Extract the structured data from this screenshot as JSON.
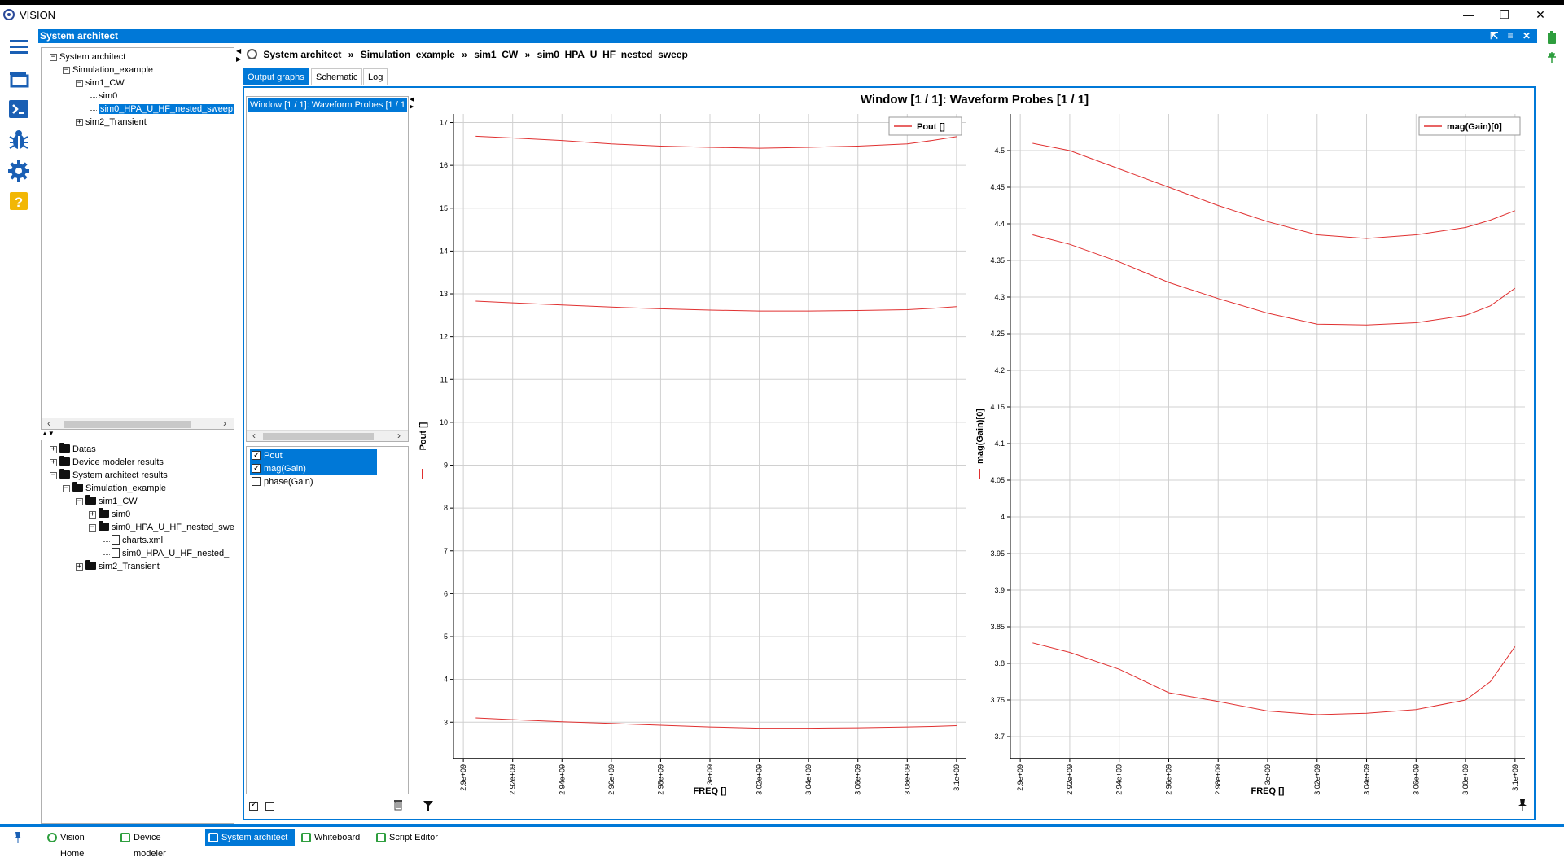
{
  "app": {
    "title": "VISION",
    "window_controls": {
      "minimize": "—",
      "maximize": "❐",
      "close": "✕"
    }
  },
  "pane": {
    "title": "System architect",
    "header_buttons": "⇱ ≡ ✕"
  },
  "left_icons": [
    "menu-icon",
    "folder-stack-icon",
    "terminal-icon",
    "bug-icon",
    "gear-icon",
    "help-icon"
  ],
  "project_tree": {
    "nodes": [
      {
        "label": "System architect",
        "level": 0,
        "toggle": "−"
      },
      {
        "label": "Simulation_example",
        "level": 1,
        "toggle": "−"
      },
      {
        "label": "sim1_CW",
        "level": 2,
        "toggle": "−"
      },
      {
        "label": "sim0",
        "level": 3,
        "toggle": ""
      },
      {
        "label": "sim0_HPA_U_HF_nested_sweep",
        "level": 3,
        "toggle": "",
        "selected": true
      },
      {
        "label": "sim2_Transient",
        "level": 2,
        "toggle": "+"
      }
    ]
  },
  "results_tree": {
    "nodes": [
      {
        "label": "Datas",
        "level": 0,
        "toggle": "+",
        "icon": "folder"
      },
      {
        "label": "Device modeler results",
        "level": 0,
        "toggle": "+",
        "icon": "folder"
      },
      {
        "label": "System architect results",
        "level": 0,
        "toggle": "−",
        "icon": "folder"
      },
      {
        "label": "Simulation_example",
        "level": 1,
        "toggle": "−",
        "icon": "folder"
      },
      {
        "label": "sim1_CW",
        "level": 2,
        "toggle": "−",
        "icon": "folder"
      },
      {
        "label": "sim0",
        "level": 3,
        "toggle": "+",
        "icon": "folder"
      },
      {
        "label": "sim0_HPA_U_HF_nested_swe",
        "level": 3,
        "toggle": "−",
        "icon": "folder"
      },
      {
        "label": "charts.xml",
        "level": 4,
        "toggle": "",
        "icon": "file"
      },
      {
        "label": "sim0_HPA_U_HF_nested_",
        "level": 4,
        "toggle": "",
        "icon": "file"
      },
      {
        "label": "sim2_Transient",
        "level": 2,
        "toggle": "+",
        "icon": "folder"
      }
    ]
  },
  "breadcrumb": [
    "System architect",
    "Simulation_example",
    "sim1_CW",
    "sim0_HPA_U_HF_nested_sweep"
  ],
  "breadcrumb_sep": "»",
  "tabs": [
    {
      "label": "Output graphs",
      "active": true
    },
    {
      "label": "Schematic",
      "active": false
    },
    {
      "label": "Log",
      "active": false
    }
  ],
  "window_list": {
    "selected": "Window [1 / 1]: Waveform Probes [1 / 1"
  },
  "probes": [
    {
      "label": "Pout",
      "checked": true,
      "highlighted": true
    },
    {
      "label": "mag(Gain)",
      "checked": true,
      "highlighted": true
    },
    {
      "label": "phase(Gain)",
      "checked": false,
      "highlighted": false
    }
  ],
  "graph_window_title": "Window [1 / 1]: Waveform Probes [1 / 1]",
  "chart_data": [
    {
      "type": "line",
      "xlabel": "FREQ []",
      "ylabel": "Pout []",
      "xlim": [
        2896000000.0,
        3104000000.0
      ],
      "ylim": [
        2.15,
        17.2
      ],
      "x_ticks": [
        2900000000.0,
        2920000000.0,
        2940000000.0,
        2960000000.0,
        2980000000.0,
        3000000000.0,
        3020000000.0,
        3040000000.0,
        3060000000.0,
        3080000000.0,
        3100000000.0
      ],
      "x_tick_labels": [
        "2.9e+09",
        "2.92e+09",
        "2.94e+09",
        "2.96e+09",
        "2.98e+09",
        "3e+09",
        "3.02e+09",
        "3.04e+09",
        "3.06e+09",
        "3.08e+09",
        "3.1e+09"
      ],
      "y_ticks": [
        3,
        4,
        5,
        6,
        7,
        8,
        9,
        10,
        11,
        12,
        13,
        14,
        15,
        16,
        17
      ],
      "grid": true,
      "legend": "top-right",
      "color": "#e03030",
      "x": [
        2905000000.0,
        2920000000.0,
        2940000000.0,
        2960000000.0,
        2980000000.0,
        3000000000.0,
        3020000000.0,
        3040000000.0,
        3060000000.0,
        3080000000.0,
        3090000000.0,
        3100000000.0
      ],
      "series": [
        {
          "name": "Pout []",
          "values": [
            16.68,
            16.64,
            16.58,
            16.5,
            16.45,
            16.42,
            16.4,
            16.42,
            16.45,
            16.5,
            16.58,
            16.67
          ]
        },
        {
          "name": "Pout []",
          "values": [
            12.83,
            12.79,
            12.74,
            12.69,
            12.65,
            12.62,
            12.6,
            12.6,
            12.61,
            12.63,
            12.66,
            12.7
          ]
        },
        {
          "name": "Pout []",
          "values": [
            3.1,
            3.06,
            3.01,
            2.97,
            2.93,
            2.89,
            2.86,
            2.86,
            2.87,
            2.89,
            2.9,
            2.92
          ]
        }
      ]
    },
    {
      "type": "line",
      "xlabel": "FREQ []",
      "ylabel": "mag(Gain)[0]",
      "xlim": [
        2896000000.0,
        3104000000.0
      ],
      "ylim": [
        3.67,
        4.55
      ],
      "x_ticks": [
        2900000000.0,
        2920000000.0,
        2940000000.0,
        2960000000.0,
        2980000000.0,
        3000000000.0,
        3020000000.0,
        3040000000.0,
        3060000000.0,
        3080000000.0,
        3100000000.0
      ],
      "x_tick_labels": [
        "2.9e+09",
        "2.92e+09",
        "2.94e+09",
        "2.96e+09",
        "2.98e+09",
        "3e+09",
        "3.02e+09",
        "3.04e+09",
        "3.06e+09",
        "3.08e+09",
        "3.1e+09"
      ],
      "y_ticks": [
        3.7,
        3.75,
        3.8,
        3.85,
        3.9,
        3.95,
        4.0,
        4.05,
        4.1,
        4.15,
        4.2,
        4.25,
        4.3,
        4.35,
        4.4,
        4.45,
        4.5
      ],
      "y_tick_labels": [
        "3.7",
        "3.75",
        "3.8",
        "3.85",
        "3.9",
        "3.95",
        "4",
        "4.05",
        "4.1",
        "4.15",
        "4.2",
        "4.25",
        "4.3",
        "4.35",
        "4.4",
        "4.45",
        "4.5"
      ],
      "grid": true,
      "legend": "top-right",
      "color": "#e03030",
      "x": [
        2905000000.0,
        2920000000.0,
        2940000000.0,
        2960000000.0,
        2980000000.0,
        3000000000.0,
        3020000000.0,
        3040000000.0,
        3060000000.0,
        3080000000.0,
        3090000000.0,
        3100000000.0
      ],
      "series": [
        {
          "name": "mag(Gain)[0]",
          "values": [
            4.51,
            4.5,
            4.475,
            4.45,
            4.425,
            4.403,
            4.385,
            4.38,
            4.385,
            4.395,
            4.405,
            4.418
          ]
        },
        {
          "name": "mag(Gain)[0]",
          "values": [
            4.385,
            4.372,
            4.348,
            4.32,
            4.298,
            4.278,
            4.263,
            4.262,
            4.265,
            4.275,
            4.288,
            4.312
          ]
        },
        {
          "name": "mag(Gain)[0]",
          "values": [
            3.828,
            3.815,
            3.792,
            3.76,
            3.748,
            3.735,
            3.73,
            3.732,
            3.737,
            3.75,
            3.775,
            3.823
          ]
        }
      ]
    }
  ],
  "taskbar": [
    {
      "label": "Vision Home",
      "icon": "eye-icon",
      "active": false
    },
    {
      "label": "Device modeler",
      "icon": "bug-icon",
      "active": false
    },
    {
      "label": "System architect",
      "icon": "diagram-icon",
      "active": true
    },
    {
      "label": "Whiteboard",
      "icon": "whiteboard-icon",
      "active": false
    },
    {
      "label": "Script Editor",
      "icon": "code-icon",
      "active": false
    }
  ]
}
